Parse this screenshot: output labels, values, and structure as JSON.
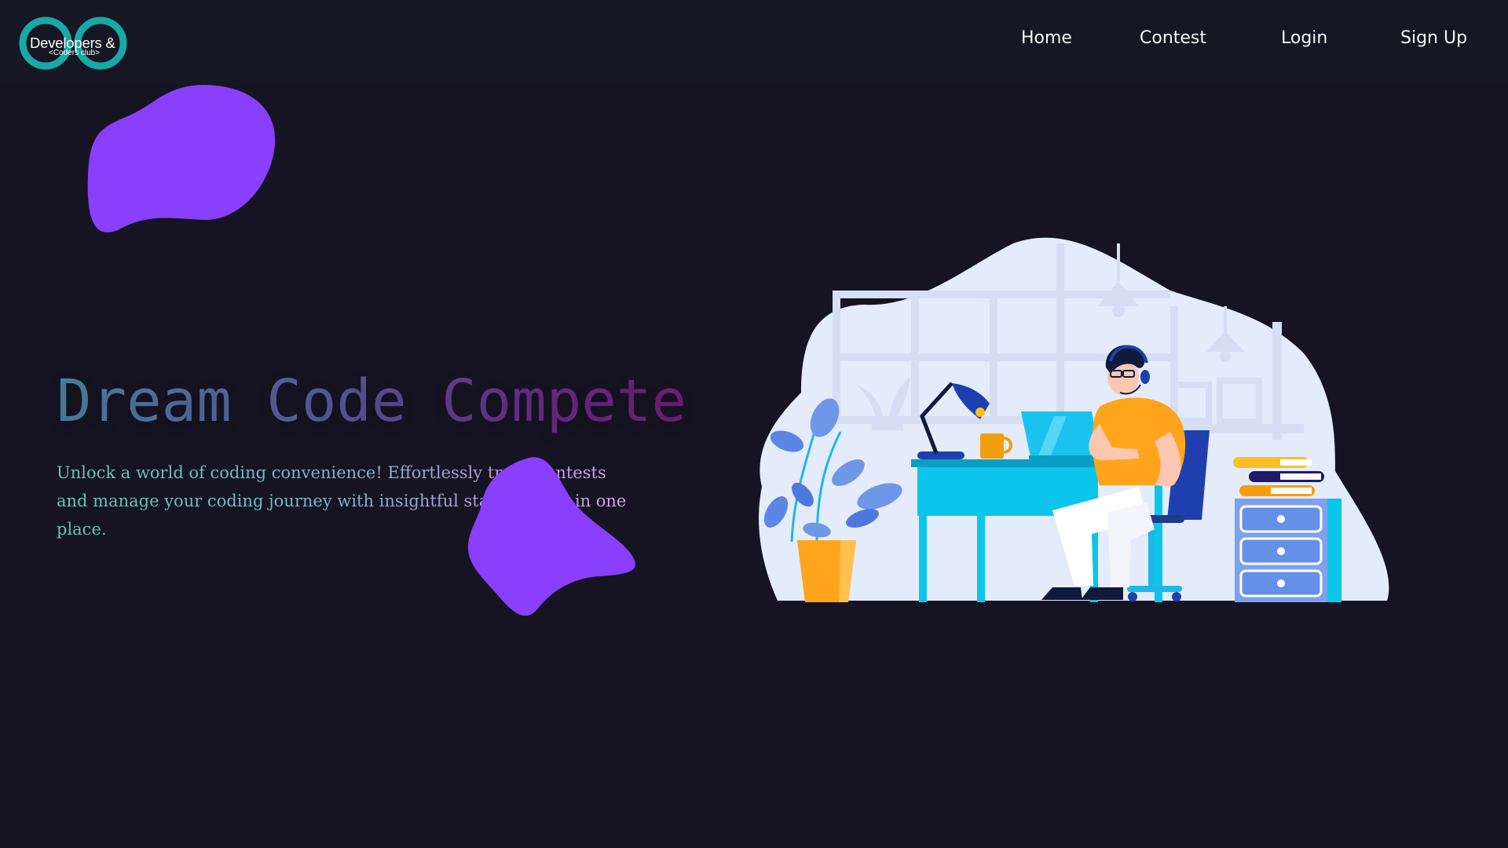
{
  "logo": {
    "main_text": "Developers &",
    "sub_text": "<Coders club>",
    "ring_color": "#16a9a6"
  },
  "nav": {
    "items": [
      {
        "label": "Home"
      },
      {
        "label": "Contest"
      },
      {
        "label": "Login"
      },
      {
        "label": "Sign Up"
      }
    ]
  },
  "hero": {
    "title": "Dream Code Compete",
    "description": "Unlock a world of coding convenience! Effortlessly track contests and manage your coding journey with insightful statistics, all in one place."
  },
  "colors": {
    "background": "#161422",
    "blob": "#8a3ffc",
    "accent_cyan": "#0bc5ea",
    "accent_orange": "#ffa41b"
  },
  "icons": {
    "logo": "infinity-logo-icon",
    "illustration": "developer-at-desk-illustration"
  }
}
